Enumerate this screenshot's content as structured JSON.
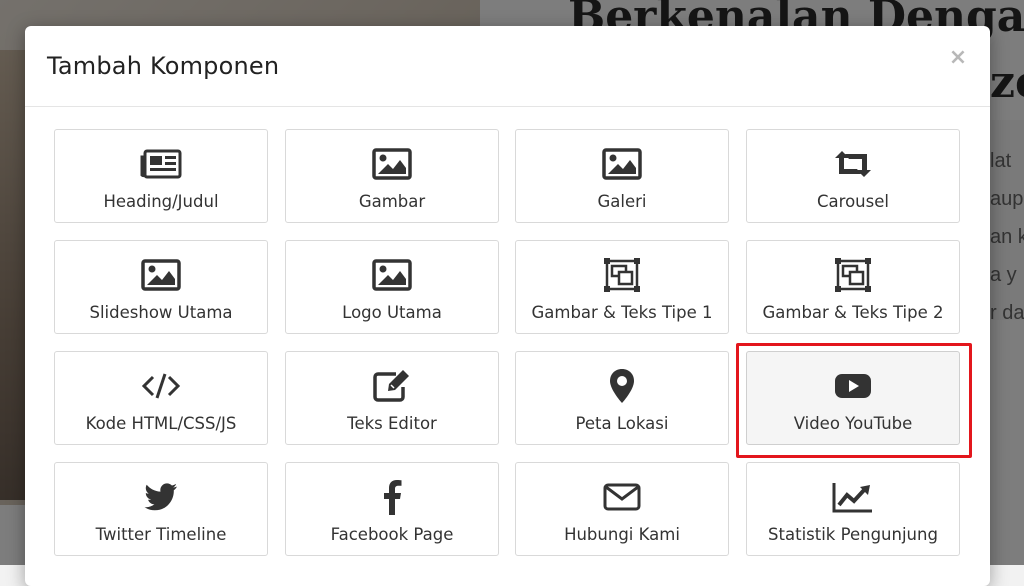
{
  "background": {
    "heading_line1": "Berkenalan Dengan",
    "heading_line2": "ze",
    "paragraph_fragments": [
      "lat",
      "aup",
      "an k",
      "a y",
      "r da"
    ]
  },
  "modal": {
    "title": "Tambah Komponen",
    "close_label": "×"
  },
  "components": [
    {
      "label": "Heading/Judul",
      "icon": "newspaper-icon"
    },
    {
      "label": "Gambar",
      "icon": "image-icon"
    },
    {
      "label": "Galeri",
      "icon": "image-icon"
    },
    {
      "label": "Carousel",
      "icon": "retweet-icon"
    },
    {
      "label": "Slideshow Utama",
      "icon": "image-icon"
    },
    {
      "label": "Logo Utama",
      "icon": "image-icon"
    },
    {
      "label": "Gambar & Teks Tipe 1",
      "icon": "object-group-icon"
    },
    {
      "label": "Gambar & Teks Tipe 2",
      "icon": "object-group-icon"
    },
    {
      "label": "Kode HTML/CSS/JS",
      "icon": "code-icon"
    },
    {
      "label": "Teks Editor",
      "icon": "edit-icon"
    },
    {
      "label": "Peta Lokasi",
      "icon": "map-marker-icon"
    },
    {
      "label": "Video YouTube",
      "icon": "youtube-icon"
    },
    {
      "label": "Twitter Timeline",
      "icon": "twitter-icon"
    },
    {
      "label": "Facebook Page",
      "icon": "facebook-icon"
    },
    {
      "label": "Hubungi Kami",
      "icon": "envelope-icon"
    },
    {
      "label": "Statistik Pengunjung",
      "icon": "line-chart-icon"
    }
  ],
  "highlighted_component": "Video YouTube",
  "colors": {
    "highlight": "#e3161c",
    "icon": "#333333",
    "overlay": "rgba(0,0,0,0.5)"
  }
}
